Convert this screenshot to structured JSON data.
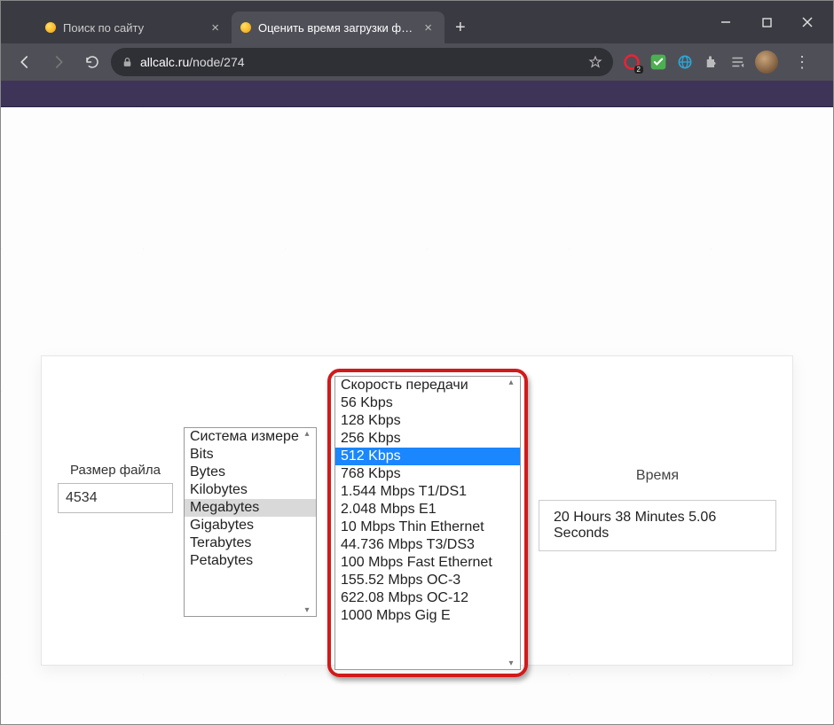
{
  "window": {
    "tabs": [
      {
        "title": "Поиск по сайту",
        "active": false
      },
      {
        "title": "Оценить время загрузки файла",
        "active": true
      }
    ],
    "url_domain": "allcalc.ru",
    "url_path": "/node/274",
    "ext_badge": "2"
  },
  "card": {
    "file_label": "Размер файла",
    "file_value": "4534",
    "unit_header": "Система измере",
    "units": [
      "Bits",
      "Bytes",
      "Kilobytes",
      "Megabytes",
      "Gigabytes",
      "Terabytes",
      "Petabytes"
    ],
    "unit_selected": "Megabytes",
    "speed_header": "Скорость передачи",
    "speeds": [
      "56 Kbps",
      "128 Kbps",
      "256 Kbps",
      "512 Kbps",
      "768 Kbps",
      "1.544 Mbps T1/DS1",
      "2.048 Mbps E1",
      "10 Mbps Thin Ethernet",
      "44.736 Mbps T3/DS3",
      "100 Mbps Fast Ethernet",
      "155.52 Mbps OC-3",
      "622.08 Mbps OC-12",
      "1000 Mbps Gig E"
    ],
    "speed_selected": "512 Kbps",
    "time_label": "Время",
    "time_value": "20 Hours 38 Minutes 5.06 Seconds"
  }
}
